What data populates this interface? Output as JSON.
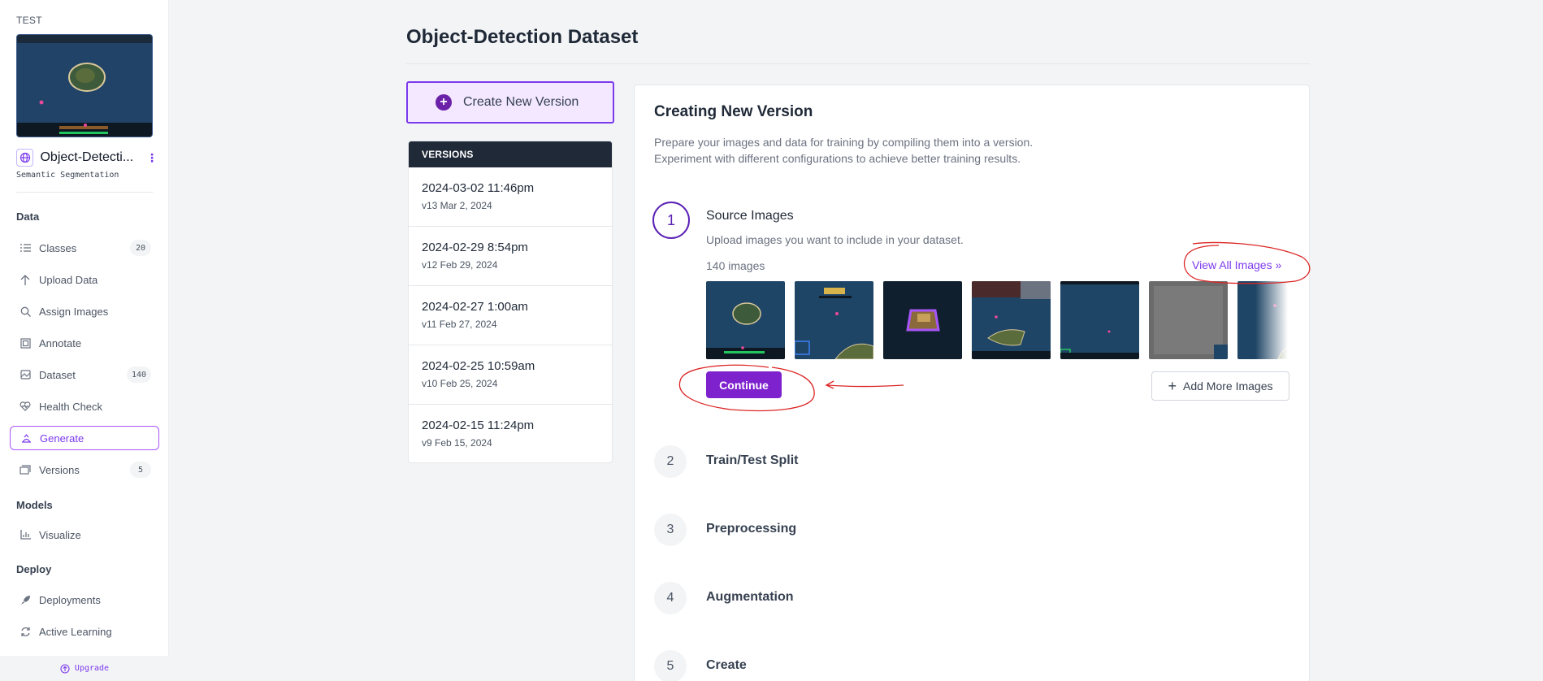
{
  "sidebar": {
    "workspace": "TEST",
    "project_name": "Object-Detecti...",
    "project_type": "Semantic Segmentation",
    "sections": {
      "data": "Data",
      "models": "Models",
      "deploy": "Deploy"
    },
    "items": [
      {
        "label": "Classes",
        "icon": "list-icon",
        "count": "20"
      },
      {
        "label": "Upload Data",
        "icon": "upload-icon"
      },
      {
        "label": "Assign Images",
        "icon": "search-icon"
      },
      {
        "label": "Annotate",
        "icon": "annotate-icon"
      },
      {
        "label": "Dataset",
        "icon": "images-icon",
        "count": "140"
      },
      {
        "label": "Health Check",
        "icon": "heart-icon"
      },
      {
        "label": "Generate",
        "icon": "generate-icon",
        "active": true
      },
      {
        "label": "Versions",
        "icon": "versions-icon",
        "count": "5"
      },
      {
        "label": "Visualize",
        "icon": "chart-icon"
      },
      {
        "label": "Deployments",
        "icon": "rocket-icon"
      },
      {
        "label": "Active Learning",
        "icon": "loop-icon"
      }
    ],
    "upgrade": "Upgrade"
  },
  "main": {
    "title": "Object-Detection Dataset",
    "create_version": "Create New Version",
    "versions_header": "VERSIONS",
    "versions": [
      {
        "date": "2024-03-02 11:46pm",
        "sub": "v13 Mar 2, 2024"
      },
      {
        "date": "2024-02-29 8:54pm",
        "sub": "v12 Feb 29, 2024"
      },
      {
        "date": "2024-02-27 1:00am",
        "sub": "v11 Feb 27, 2024"
      },
      {
        "date": "2024-02-25 10:59am",
        "sub": "v10 Feb 25, 2024"
      },
      {
        "date": "2024-02-15 11:24pm",
        "sub": "v9 Feb 15, 2024"
      }
    ]
  },
  "panel": {
    "title": "Creating New Version",
    "desc_line1": "Prepare your images and data for training by compiling them into a version.",
    "desc_line2": "Experiment with different configurations to achieve better training results.",
    "steps": [
      {
        "num": "1",
        "title": "Source Images"
      },
      {
        "num": "2",
        "title": "Train/Test Split"
      },
      {
        "num": "3",
        "title": "Preprocessing"
      },
      {
        "num": "4",
        "title": "Augmentation"
      },
      {
        "num": "5",
        "title": "Create"
      }
    ],
    "source_subtitle": "Upload images you want to include in your dataset.",
    "image_count": "140 images",
    "view_all": "View All Images »",
    "continue": "Continue",
    "add_more": "Add More Images"
  },
  "colors": {
    "accent": "#7c3aed",
    "sidebar_bg": "#ffffff",
    "page_bg": "#f3f4f6",
    "annotation_red": "#dc2626"
  }
}
